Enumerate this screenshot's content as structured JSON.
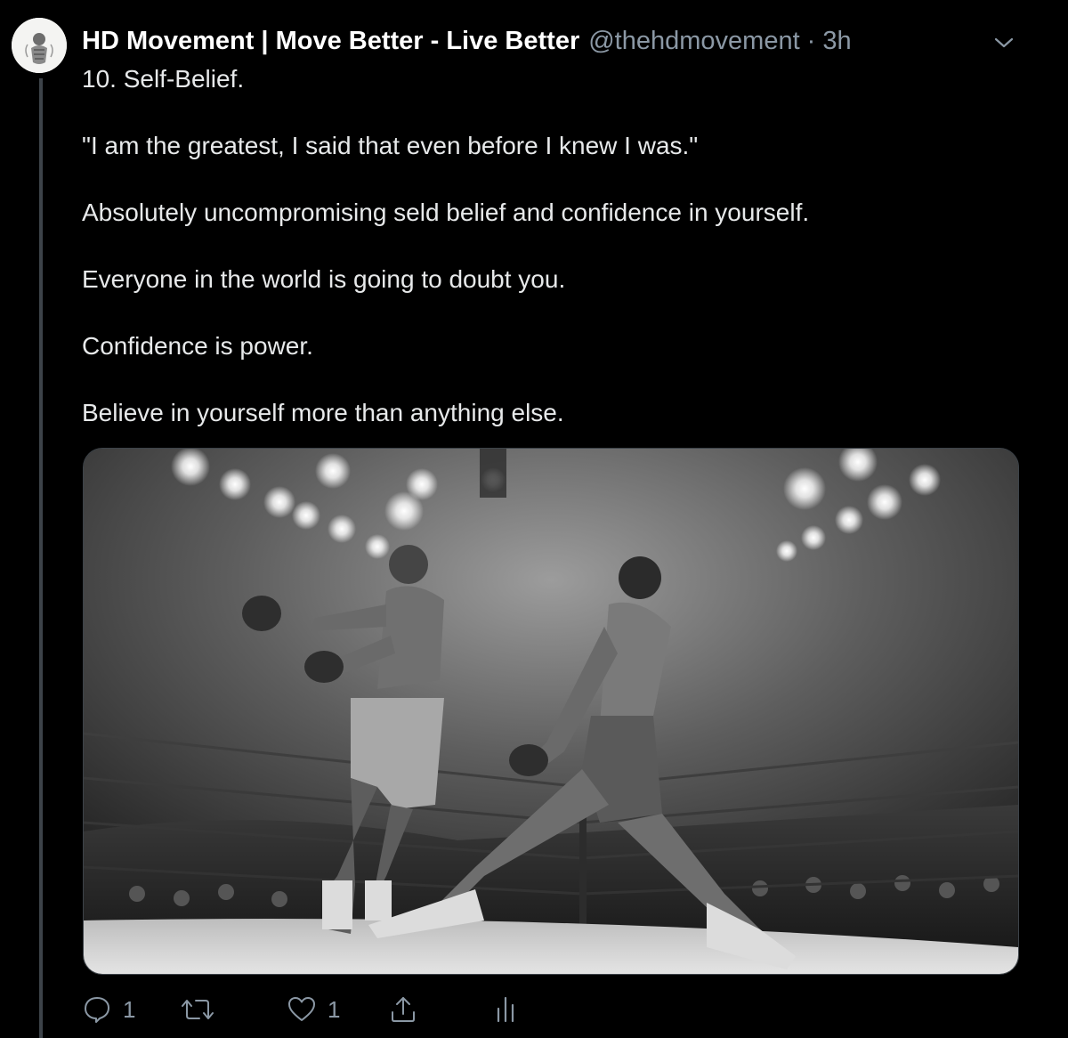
{
  "tweet": {
    "display_name": "HD Movement | Move Better - Live Better",
    "handle": "@thehdmovement",
    "separator": "·",
    "time": "3h",
    "paragraphs": [
      "10. Self-Belief.",
      "\"I am the greatest, I said that even before I knew I was.\"",
      "Absolutely uncompromising seld belief and confidence in yourself.",
      "Everyone in the world is going to doubt you.",
      "Confidence is power.",
      "Believe in yourself more than anything else."
    ]
  },
  "actions": {
    "reply_count": "1",
    "retweet_count": "",
    "like_count": "1"
  },
  "icons": {
    "more": "chevron-down-icon",
    "reply": "reply-icon",
    "retweet": "retweet-icon",
    "like": "heart-icon",
    "share": "share-icon",
    "analytics": "analytics-icon"
  },
  "colors": {
    "background": "#000000",
    "text": "#e7e9ea",
    "secondary": "#8b98a5",
    "thread_line": "#3d4349"
  }
}
